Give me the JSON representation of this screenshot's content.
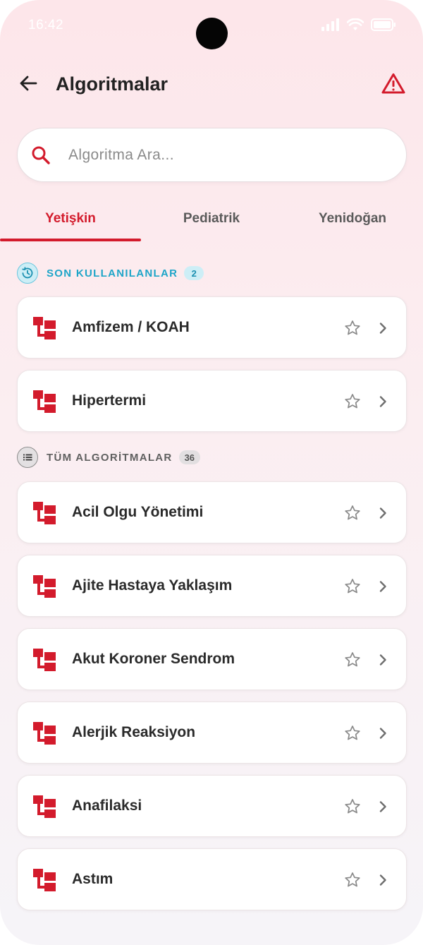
{
  "status_bar": {
    "time": "16:42"
  },
  "header": {
    "title": "Algoritmalar"
  },
  "search": {
    "placeholder": "Algoritma Ara..."
  },
  "tabs": [
    {
      "label": "Yetişkin",
      "active": true
    },
    {
      "label": "Pediatrik",
      "active": false
    },
    {
      "label": "Yenidoğan",
      "active": false
    }
  ],
  "recent": {
    "label": "SON KULLANILANLAR",
    "count": "2",
    "items": [
      {
        "title": "Amfizem / KOAH"
      },
      {
        "title": "Hipertermi"
      }
    ]
  },
  "all": {
    "label": "TÜM ALGORİTMALAR",
    "count": "36",
    "items": [
      {
        "title": "Acil Olgu Yönetimi"
      },
      {
        "title": "Ajite Hastaya Yaklaşım"
      },
      {
        "title": "Akut Koroner Sendrom"
      },
      {
        "title": "Alerjik Reaksiyon"
      },
      {
        "title": "Anafilaksi"
      },
      {
        "title": "Astım"
      }
    ]
  },
  "colors": {
    "accent": "#d31b2c",
    "recent_accent": "#1ea5c8",
    "muted": "#606060"
  },
  "icons": {
    "back": "arrow-left-icon",
    "warning": "warning-triangle-icon",
    "search": "search-icon",
    "recent": "history-icon",
    "all": "list-icon",
    "algorithm": "flowchart-icon",
    "favorite": "star-outline-icon",
    "open": "chevron-right-icon"
  }
}
